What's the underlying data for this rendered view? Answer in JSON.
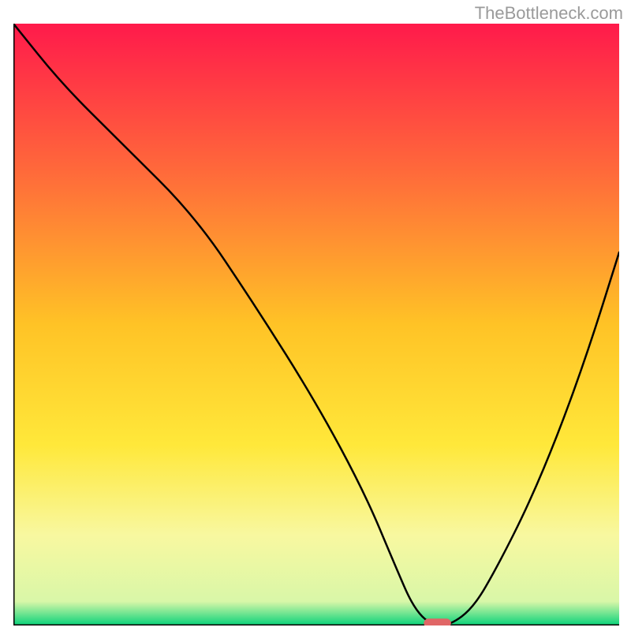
{
  "watermark": "TheBottleneck.com",
  "chart_data": {
    "type": "line",
    "title": "",
    "xlabel": "",
    "ylabel": "",
    "xlim": [
      0,
      100
    ],
    "ylim": [
      0,
      100
    ],
    "gradient_stops": [
      {
        "offset": 0.0,
        "color": "#ff1a4b"
      },
      {
        "offset": 0.25,
        "color": "#ff6b3a"
      },
      {
        "offset": 0.5,
        "color": "#ffc326"
      },
      {
        "offset": 0.7,
        "color": "#ffe83a"
      },
      {
        "offset": 0.85,
        "color": "#f8f8a0"
      },
      {
        "offset": 0.96,
        "color": "#d9f7a8"
      },
      {
        "offset": 1.0,
        "color": "#07d27a"
      }
    ],
    "series": [
      {
        "name": "bottleneck-curve",
        "x": [
          0,
          8,
          18,
          30,
          40,
          50,
          58,
          63,
          66,
          69,
          72,
          76,
          80,
          85,
          90,
          95,
          100
        ],
        "y": [
          100,
          90,
          80,
          68,
          53,
          37,
          22,
          10,
          3,
          0,
          0,
          3,
          10,
          20,
          32,
          46,
          62
        ]
      }
    ],
    "marker": {
      "name": "optimal-marker",
      "x": 70,
      "y": 0,
      "color": "#e06666",
      "width": 4.5,
      "height": 1.5
    },
    "axes": {
      "left": {
        "x": 0,
        "y0": 0,
        "y1": 100
      },
      "bottom": {
        "y": 0,
        "x0": 0,
        "x1": 100
      }
    }
  }
}
